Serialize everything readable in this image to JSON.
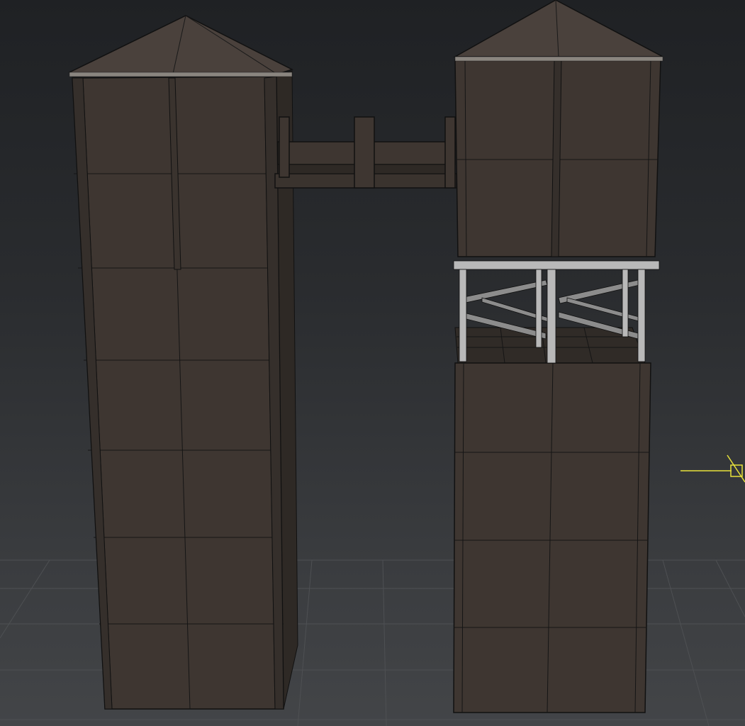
{
  "viewport": {
    "background_top": "#1f2124",
    "background_bottom": "#434548",
    "grid_color": "#4e5053"
  },
  "scene": {
    "objects": [
      {
        "name": "left-tower",
        "roof": "pyramid"
      },
      {
        "name": "right-tower-base",
        "roof": "none"
      },
      {
        "name": "water-tank",
        "roof": "pyramid"
      },
      {
        "name": "tank-scaffold",
        "roof": "none"
      },
      {
        "name": "connecting-bridge",
        "roof": "none"
      }
    ],
    "colors": {
      "wall": "#3e3631",
      "wall_dark": "#2e2925",
      "roof": "#4a413c",
      "edge": "#111111",
      "scaffold": "#b9b9b9",
      "scaffold_shade": "#8c8c8c",
      "gizmo": "#e8e23a"
    }
  },
  "gizmo": {
    "icon": "light-target-icon"
  }
}
